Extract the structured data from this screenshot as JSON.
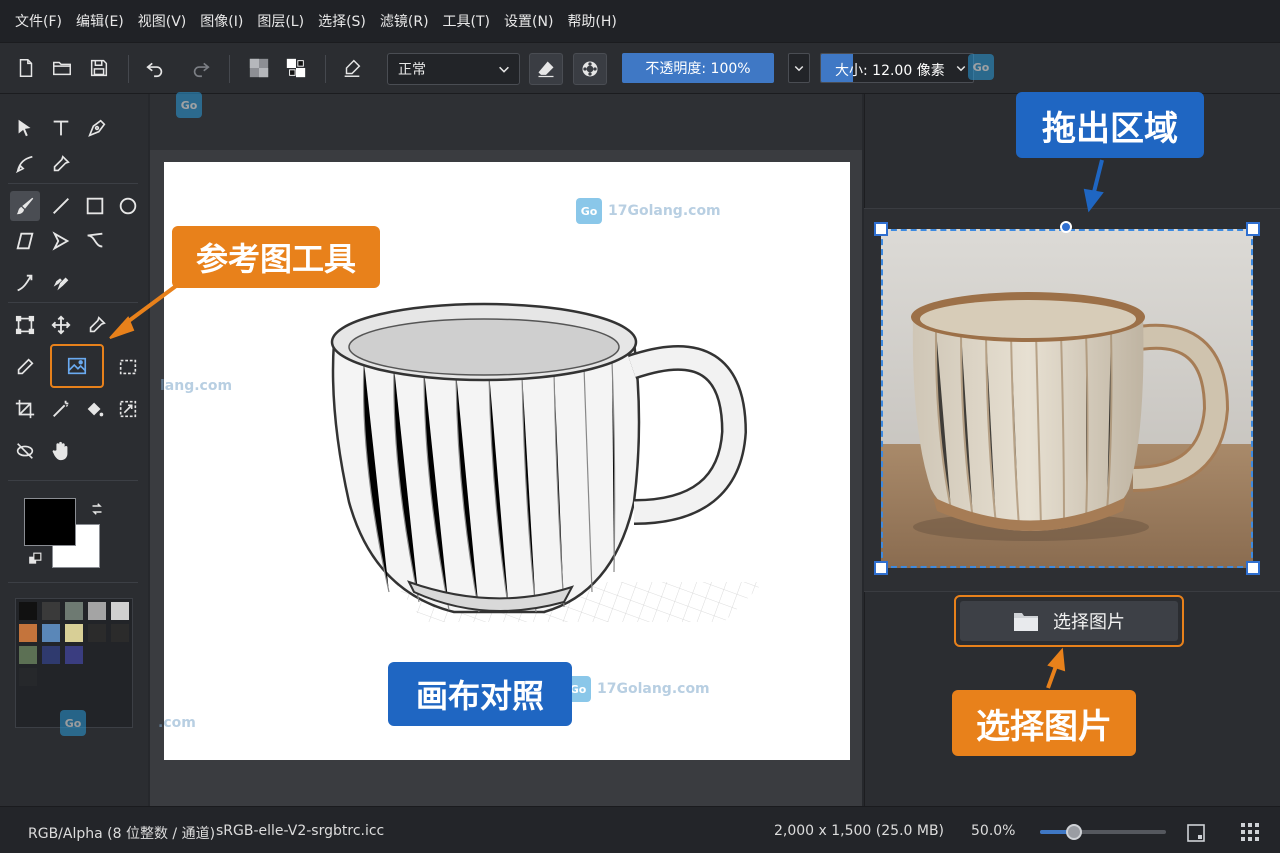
{
  "menu": [
    "文件(F)",
    "编辑(E)",
    "视图(V)",
    "图像(I)",
    "图层(L)",
    "选择(S)",
    "滤镜(R)",
    "工具(T)",
    "设置(N)",
    "帮助(H)"
  ],
  "toolbar": {
    "blend_mode": "正常",
    "opacity_label": "不透明度: 100%",
    "opacity_value": 1.0,
    "size_label": "大小: 12.00 像素"
  },
  "callouts": {
    "reference_tool": "参考图工具",
    "drag_region": "拖出区域",
    "canvas_compare": "画布对照",
    "choose_image": "选择图片"
  },
  "reference_panel": {
    "choose_button_label": "选择图片"
  },
  "colors": {
    "foreground": "#000000",
    "background": "#ffffff",
    "accent": "#3f78c5",
    "callout_orange": "#e8811b",
    "callout_blue": "#1f66c2"
  },
  "palette": [
    "#111111",
    "#3a3a3a",
    "#6e7a72",
    "#a4a4a4",
    "#d0d0d0",
    "#c4743c",
    "#5a87b8",
    "#d8cf96",
    "#2b2b2b",
    "#2b2b2b",
    "#5c7054",
    "#2f3a6e",
    "#3a3d80"
  ],
  "status": {
    "color_model": "RGB/Alpha (8 位整数 / 通道)",
    "profile": "sRGB-elle-V2-srgbtrc.icc",
    "dimensions": "2,000 x 1,500 (25.0 MB)",
    "zoom": "50.0%"
  },
  "watermark": {
    "logo": "Go",
    "text": "17Golang.com",
    "partial_text": "lang.com",
    "short_text": ".com"
  }
}
